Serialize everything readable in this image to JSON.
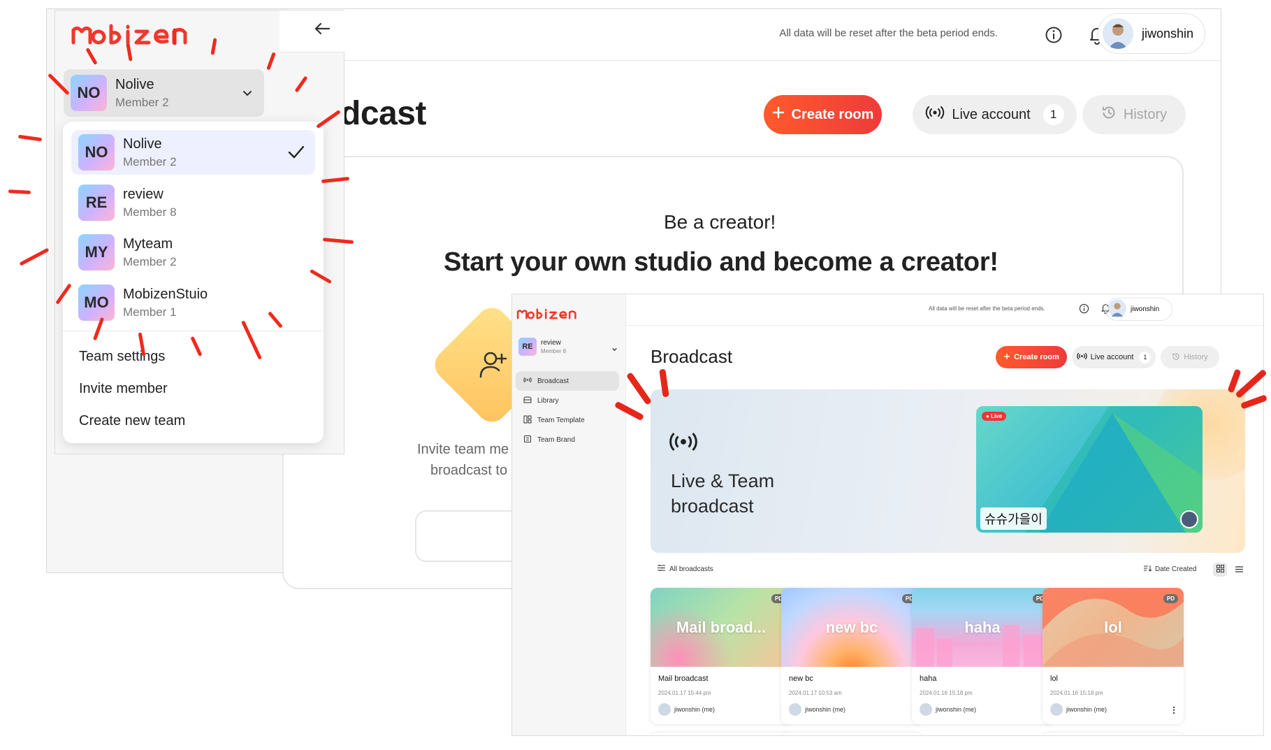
{
  "back": {
    "beta_note": "All data will be reset after the beta period ends.",
    "username": "jiwonshin",
    "title": "dcast",
    "create_room": "Create room",
    "live_account": "Live account",
    "live_count": "1",
    "history": "History",
    "be_creator": "Be a creator!",
    "start_studio": "Start your own studio and become a creator!",
    "invite_line1": "Invite team me",
    "invite_line2": "broadcast to"
  },
  "panel": {
    "logo": "Mobizen",
    "current_team": {
      "badge": "NO",
      "name": "Nolive",
      "members": "Member 2"
    },
    "teams": [
      {
        "badge": "NO",
        "name": "Nolive",
        "members": "Member 2"
      },
      {
        "badge": "RE",
        "name": "review",
        "members": "Member 8"
      },
      {
        "badge": "MY",
        "name": "Myteam",
        "members": "Member 2"
      },
      {
        "badge": "MO",
        "name": "MobizenStuio",
        "members": "Member 1"
      }
    ],
    "actions": [
      "Team settings",
      "Invite member",
      "Create new team"
    ]
  },
  "front": {
    "logo": "Mobizen",
    "beta_note": "All data will be reset after the beta period ends.",
    "username": "jiwonshin",
    "team": {
      "badge": "RE",
      "name": "review",
      "members": "Member 8"
    },
    "nav": [
      "Broadcast",
      "Library",
      "Team Template",
      "Team Brand"
    ],
    "title": "Broadcast",
    "create_room": "Create room",
    "live_account": "Live account",
    "live_count": "1",
    "history": "History",
    "hero_line1": "Live & Team",
    "hero_line2": "broadcast",
    "live_badge": "Live",
    "live_name": "슈슈가을이",
    "all_broadcasts": "All broadcasts",
    "sort_label": "Date Created",
    "cards": [
      {
        "thumb_title": "Mail broad...",
        "badge": "PD",
        "name": "Mail broadcast",
        "date": "2024.01.17 15:44 pm",
        "owner": "jiwonshin (me)"
      },
      {
        "thumb_title": "new bc",
        "badge": "PD",
        "name": "new bc",
        "date": "2024.01.17 10:53 am",
        "owner": "jiwonshin (me)"
      },
      {
        "thumb_title": "haha",
        "badge": "PD",
        "name": "haha",
        "date": "2024.01.16 15:18 pm",
        "owner": "jiwonshin (me)"
      },
      {
        "thumb_title": "lol",
        "badge": "PD",
        "name": "lol",
        "date": "2024.01.16 15:18 pm",
        "owner": "jiwonshin (me)"
      }
    ]
  },
  "colors": {
    "accent": "#ef3b3b",
    "accent_orange": "#ff5a2c",
    "annotation_red": "#ef2a1e"
  }
}
